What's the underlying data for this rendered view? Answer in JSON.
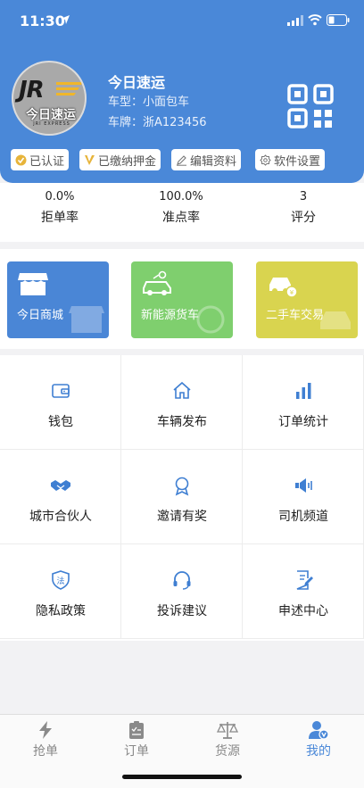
{
  "status_bar": {
    "time": "11:30"
  },
  "profile": {
    "logo_mark": "JR",
    "logo_cn": "今日速运",
    "logo_en": "JRI EXPRESS",
    "company_name": "今日速运",
    "vehicle_type": "车型：小面包车",
    "plate": "车牌：浙A123456"
  },
  "tags": [
    {
      "label": "已认证",
      "icon": "check-badge-icon"
    },
    {
      "label": "已缴纳押金",
      "icon": "v-badge-icon"
    },
    {
      "label": "编辑资料",
      "icon": "pencil-icon"
    },
    {
      "label": "软件设置",
      "icon": "gear-icon"
    }
  ],
  "stats": [
    {
      "value": "0.0%",
      "label": "拒单率"
    },
    {
      "value": "100.0%",
      "label": "准点率"
    },
    {
      "value": "3",
      "label": "评分"
    }
  ],
  "cards": [
    {
      "label": "今日商城",
      "color": "#4a86d6",
      "icon": "store-icon"
    },
    {
      "label": "新能源货车",
      "color": "#7fcf6e",
      "icon": "ev-truck-icon"
    },
    {
      "label": "二手车交易",
      "color": "#d9d44f",
      "icon": "used-car-icon"
    }
  ],
  "grid": [
    {
      "label": "钱包",
      "icon": "wallet-icon"
    },
    {
      "label": "车辆发布",
      "icon": "home-icon"
    },
    {
      "label": "订单统计",
      "icon": "bar-chart-icon"
    },
    {
      "label": "城市合伙人",
      "icon": "handshake-icon"
    },
    {
      "label": "邀请有奖",
      "icon": "medal-icon"
    },
    {
      "label": "司机频道",
      "icon": "megaphone-icon"
    },
    {
      "label": "隐私政策",
      "icon": "shield-law-icon"
    },
    {
      "label": "投诉建议",
      "icon": "headset-icon"
    },
    {
      "label": "申述中心",
      "icon": "document-edit-icon"
    }
  ],
  "tabbar": [
    {
      "label": "抢单",
      "icon": "lightning-icon",
      "active": false
    },
    {
      "label": "订单",
      "icon": "clipboard-icon",
      "active": false
    },
    {
      "label": "货源",
      "icon": "scale-icon",
      "active": false
    },
    {
      "label": "我的",
      "icon": "user-icon",
      "active": true
    }
  ],
  "colors": {
    "primary": "#4a88d8",
    "icon_blue": "#3f7fd2",
    "inactive": "#888888"
  }
}
